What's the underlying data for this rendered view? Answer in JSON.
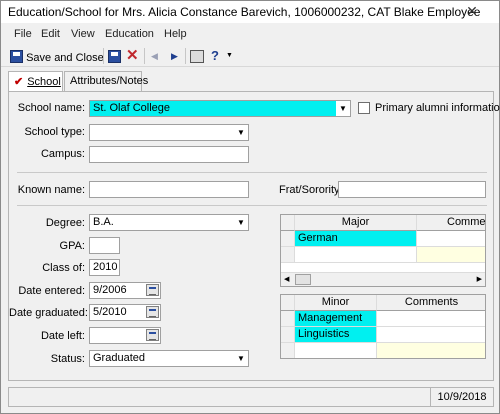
{
  "window": {
    "title": "Education/School for Mrs. Alicia Constance Barevich, 1006000232, CAT Blake Employee",
    "close_glyph": "✕"
  },
  "menu": [
    "File",
    "Edit",
    "View",
    "Education",
    "Help"
  ],
  "toolbar": {
    "save_close_label": "Save and Close",
    "icons": [
      "save-icon",
      "delete-icon",
      "first-record-icon",
      "previous-record-icon",
      "next-record-icon",
      "print-icon",
      "help-icon"
    ]
  },
  "tabs": {
    "school": "School",
    "attributes": "Attributes/Notes"
  },
  "form": {
    "school_name_label": "School name:",
    "school_name_value": "St. Olaf College",
    "primary_alumni_label": "Primary alumni information",
    "school_type_label": "School type:",
    "school_type_value": "",
    "campus_label": "Campus:",
    "campus_value": "",
    "known_name_label": "Known name:",
    "known_name_value": "",
    "frat_label": "Frat/Sorority:",
    "frat_value": "",
    "degree_label": "Degree:",
    "degree_value": "B.A.",
    "gpa_label": "GPA:",
    "gpa_value": "",
    "class_of_label": "Class of:",
    "class_of_value": "2010",
    "date_entered_label": "Date entered:",
    "date_entered_value": "9/2006",
    "date_graduated_label": "Date graduated:",
    "date_graduated_value": "5/2010",
    "date_left_label": "Date left:",
    "date_left_value": "",
    "status_label": "Status:",
    "status_value": "Graduated"
  },
  "major_grid": {
    "headers": [
      "Major",
      "Commen"
    ],
    "rows": [
      [
        "German",
        ""
      ]
    ]
  },
  "minor_grid": {
    "headers": [
      "Minor",
      "Comments"
    ],
    "rows": [
      [
        "Management",
        ""
      ],
      [
        "Linguistics",
        ""
      ]
    ]
  },
  "status_bar": {
    "date": "10/9/2018"
  },
  "colors": {
    "highlight": "#00f0f0",
    "new_row": "#ffffe1",
    "check_mark": "#c00000"
  }
}
